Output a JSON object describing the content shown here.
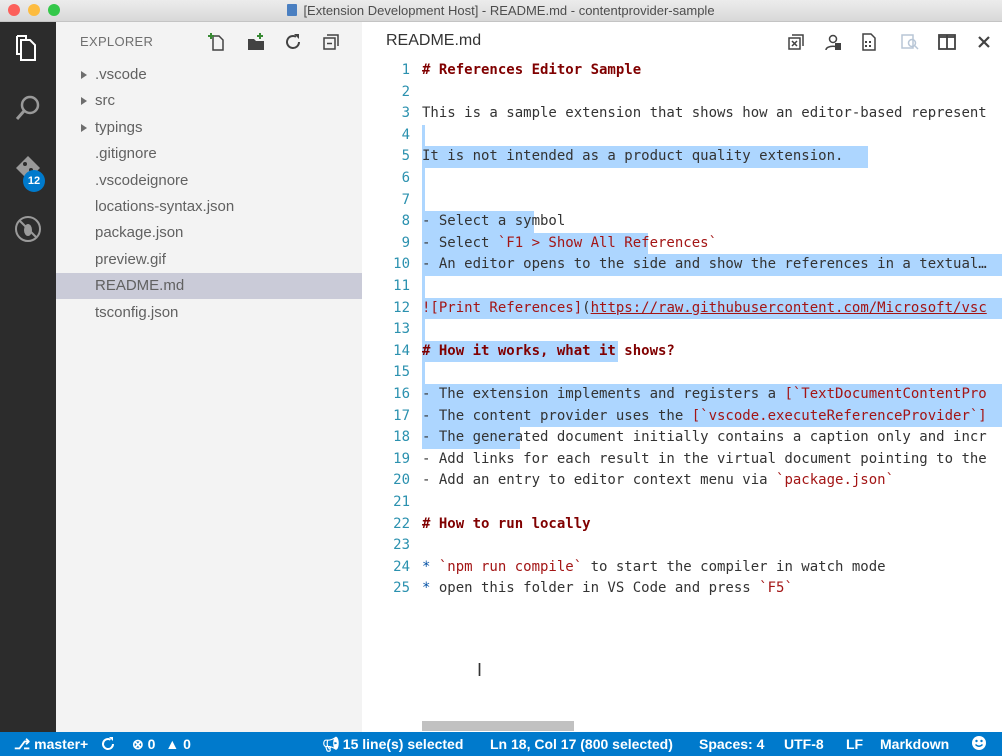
{
  "window": {
    "title": "[Extension Development Host] - README.md - contentprovider-sample",
    "traffic_colors": [
      "#fc605b",
      "#fdbc40",
      "#34c84a"
    ]
  },
  "activity_bar": {
    "items": [
      "files-icon",
      "search-icon",
      "git-icon",
      "debug-icon"
    ],
    "git_badge": "12"
  },
  "sidebar": {
    "title": "EXPLORER",
    "actions": [
      "new-file-icon",
      "new-folder-icon",
      "refresh-icon",
      "collapse-all-icon"
    ],
    "items": [
      {
        "label": ".vscode",
        "folder": true
      },
      {
        "label": "src",
        "folder": true
      },
      {
        "label": "typings",
        "folder": true
      },
      {
        "label": ".gitignore",
        "folder": false
      },
      {
        "label": ".vscodeignore",
        "folder": false
      },
      {
        "label": "locations-syntax.json",
        "folder": false
      },
      {
        "label": "package.json",
        "folder": false
      },
      {
        "label": "preview.gif",
        "folder": false
      },
      {
        "label": "README.md",
        "folder": false,
        "selected": true
      },
      {
        "label": "tsconfig.json",
        "folder": false
      }
    ]
  },
  "editor": {
    "tab_title": "README.md",
    "actions": [
      "close-others-icon",
      "open-changes-icon",
      "preview-icon",
      "find-icon",
      "split-editor-icon",
      "close-icon"
    ],
    "lines": [
      {
        "n": "1",
        "parts": [
          {
            "t": "# References Editor Sample",
            "c": "head"
          }
        ]
      },
      {
        "n": "2",
        "parts": []
      },
      {
        "n": "3",
        "parts": [
          {
            "t": "This is a sample extension that shows how an editor-based represent",
            "c": ""
          }
        ]
      },
      {
        "n": "4",
        "parts": [],
        "sel": "4"
      },
      {
        "n": "5",
        "parts": [
          {
            "t": "It is not intended as a product quality extension.",
            "c": ""
          }
        ],
        "sel": "620"
      },
      {
        "n": "6",
        "parts": [],
        "sel": "4"
      },
      {
        "n": "7",
        "parts": [],
        "sel": "4"
      },
      {
        "n": "8",
        "parts": [
          {
            "t": "- Select a symbol",
            "c": ""
          }
        ],
        "sel": "156"
      },
      {
        "n": "9",
        "parts": [
          {
            "t": "- Select ",
            "c": ""
          },
          {
            "t": "`F1 > Show All References`",
            "c": "red"
          }
        ],
        "sel": "314"
      },
      {
        "n": "10",
        "parts": [
          {
            "t": "- An editor opens to the side and show the references in a textual…",
            "c": ""
          }
        ],
        "sel": "full"
      },
      {
        "n": "11",
        "parts": [],
        "sel": "4"
      },
      {
        "n": "12",
        "parts": [
          {
            "t": "![Print References]",
            "c": "red"
          },
          {
            "t": "(",
            "c": ""
          },
          {
            "t": "https://raw.githubusercontent.com/Microsoft/vsc",
            "c": "link"
          }
        ],
        "sel": "full"
      },
      {
        "n": "13",
        "parts": [],
        "sel": "4"
      },
      {
        "n": "14",
        "parts": [
          {
            "t": "# How it works, what it shows?",
            "c": "head"
          }
        ],
        "sel": "272"
      },
      {
        "n": "15",
        "parts": [],
        "sel": "4"
      },
      {
        "n": "16",
        "parts": [
          {
            "t": "- The extension implements and registers a ",
            "c": ""
          },
          {
            "t": "[`TextDocumentContentPro",
            "c": "red"
          }
        ],
        "sel": "full"
      },
      {
        "n": "17",
        "parts": [
          {
            "t": "- The content provider uses the ",
            "c": ""
          },
          {
            "t": "[`vscode.executeReferenceProvider`]",
            "c": "red"
          }
        ],
        "sel": "full"
      },
      {
        "n": "18",
        "parts": [
          {
            "t": "- The generated document initially contains a caption only and incr",
            "c": ""
          }
        ],
        "sel": "136"
      },
      {
        "n": "19",
        "parts": [
          {
            "t": "- Add links for each result in the virtual document pointing to the",
            "c": ""
          }
        ]
      },
      {
        "n": "20",
        "parts": [
          {
            "t": "- Add an entry to editor context menu via ",
            "c": ""
          },
          {
            "t": "`package.json`",
            "c": "red"
          }
        ]
      },
      {
        "n": "21",
        "parts": []
      },
      {
        "n": "22",
        "parts": [
          {
            "t": "# How to run locally",
            "c": "head"
          }
        ]
      },
      {
        "n": "23",
        "parts": []
      },
      {
        "n": "24",
        "parts": [
          {
            "t": "* ",
            "c": "cyan"
          },
          {
            "t": "`npm run compile`",
            "c": "red"
          },
          {
            "t": " to start the compiler in watch mode",
            "c": ""
          }
        ]
      },
      {
        "n": "25",
        "parts": [
          {
            "t": "* ",
            "c": "cyan"
          },
          {
            "t": "open this folder in VS Code and press ",
            "c": ""
          },
          {
            "t": "`F5`",
            "c": "red"
          }
        ]
      }
    ]
  },
  "status": {
    "branch": "master+",
    "errors": "0",
    "warnings": "0",
    "selection": "15 line(s) selected",
    "position": "Ln 18, Col 17 (800 selected)",
    "spaces": "Spaces: 4",
    "encoding": "UTF-8",
    "eol": "LF",
    "language": "Markdown"
  }
}
